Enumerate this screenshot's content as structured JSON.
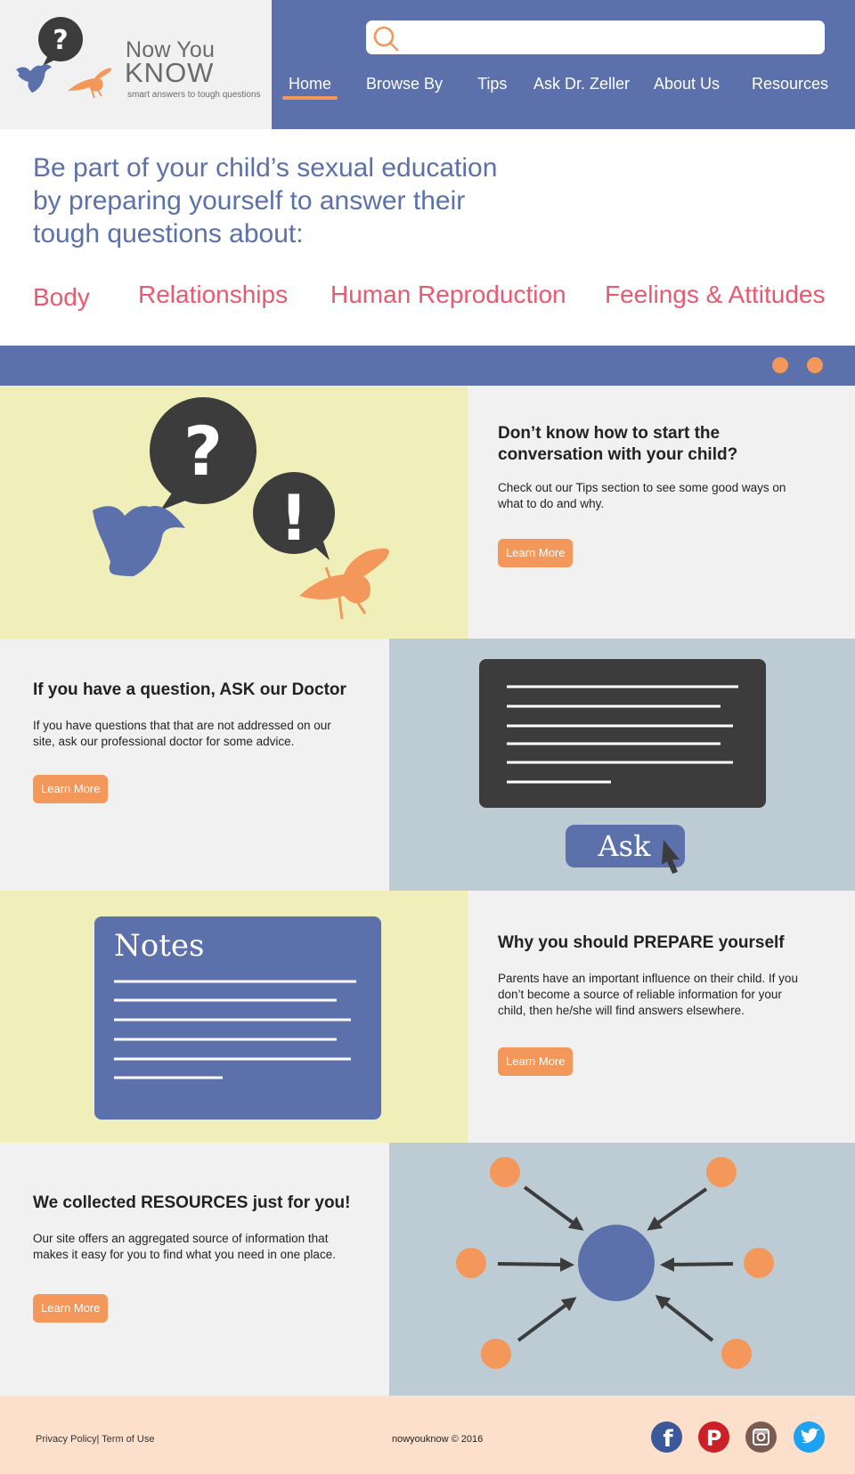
{
  "brand": {
    "name_line1": "Now You",
    "name_line2": "KNOW",
    "tagline": "smart answers to tough questions"
  },
  "search": {
    "placeholder": "",
    "icon": "search-icon"
  },
  "nav": {
    "items": [
      {
        "label": "Home",
        "active": true
      },
      {
        "label": "Browse By"
      },
      {
        "label": "Tips"
      },
      {
        "label": "Ask Dr. Zeller"
      },
      {
        "label": "About Us"
      },
      {
        "label": "Resources"
      }
    ]
  },
  "intro": {
    "line1": "Be part of your child’s sexual education",
    "line2": "by preparing yourself to answer their",
    "line3": "tough questions about:"
  },
  "topics": [
    "Body",
    "Relationships",
    "Human Reproduction",
    "Feelings & Attitudes"
  ],
  "sections": [
    {
      "title_line1": "Don’t know how to start the",
      "title_line2": "conversation with your child?",
      "body_line1": "Check out our Tips section to see some good ways on",
      "body_line2": "what to do and why.",
      "button": "Learn More"
    },
    {
      "title_line1": "If you have a question, ASK our Doctor",
      "body_line1": "If you have questions that that are not addressed on our",
      "body_line2": "site, ask our professional doctor for some advice.",
      "button": "Learn More",
      "illustration_button": "Ask"
    },
    {
      "title_line1": "Why you should PREPARE yourself",
      "body_line1": "Parents have an important influence on their child. If you",
      "body_line2": "don’t become a source of reliable information for your",
      "body_line3": "child, then he/she will find answers elsewhere.",
      "button": "Learn More",
      "illustration_title": "Notes"
    },
    {
      "title_line1": "We collected RESOURCES just for you!",
      "body_line1": "Our site offers an aggregated source of information that",
      "body_line2": "makes it easy for you to find what you need in one place.",
      "button": "Learn More"
    }
  ],
  "footer": {
    "links": "Privacy Policy| Term of Use",
    "copyright": "nowyouknow © 2016",
    "social": [
      "facebook-icon",
      "pinterest-icon",
      "instagram-icon",
      "twitter-icon"
    ]
  },
  "colors": {
    "primary_blue": "#5c71ac",
    "accent_orange": "#f4975a",
    "topic_pink": "#e85a6f",
    "panel_yellow": "#f1efb9",
    "panel_slate": "#bdcbd5",
    "footer_peach": "#fde0cb"
  }
}
